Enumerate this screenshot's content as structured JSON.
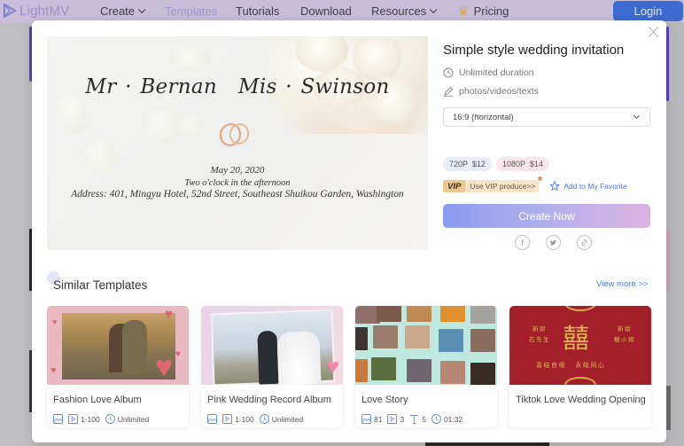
{
  "nav": {
    "logo": "LightMV",
    "items": [
      {
        "label": "Create",
        "dropdown": true
      },
      {
        "label": "Templates",
        "active": true
      },
      {
        "label": "Tutorials"
      },
      {
        "label": "Download"
      },
      {
        "label": "Resources",
        "dropdown": true
      },
      {
        "label": "Pricing",
        "icon": "crown-icon"
      }
    ],
    "login": "Login"
  },
  "modal": {
    "preview": {
      "groom": "Mr · Bernan",
      "bride": "Mis · Swinson",
      "date": "May 20, 2020",
      "time": "Two o'clock in the afternoon",
      "address": "Address: 401, Mingyu Hotel, 52nd Street, Southeast Shuikou Garden, Washington"
    },
    "title": "Simple style wedding invitation",
    "duration": "Unlimited duration",
    "media": "photos/videos/texts",
    "ratio": "16:9 (horizontal)",
    "prices": [
      {
        "label": "720P  $12"
      },
      {
        "label": "1080P  $14"
      }
    ],
    "vip_label": "VIP",
    "vip_text": "Use VIP produce>>",
    "favorite": "Add to My Favorite",
    "create_button": "Create Now",
    "share": [
      "facebook-icon",
      "twitter-icon",
      "link-icon"
    ]
  },
  "similar": {
    "title": "Similar Templates",
    "view_more": "View more >>",
    "cards": [
      {
        "name": "Fashion Love Album",
        "range": "1-100",
        "duration": "Unlimited"
      },
      {
        "name": "Pink Wedding Record Album",
        "range": "1-100",
        "duration": "Unlimited"
      },
      {
        "name": "Love Story",
        "photos": "81",
        "videos": "3",
        "texts": "5",
        "duration": "01:32"
      },
      {
        "name": "Tiktok Love Wedding Opening",
        "art": {
          "left_title": "新郎",
          "left_name": "石先生",
          "right_title": "新娘",
          "right_name": "糖小姐",
          "blessing": "喜结良缘   永结同心"
        }
      }
    ]
  },
  "colors": {
    "accent_blue": "#4a79d8",
    "login_bg": "#3e6bd0",
    "create_gradient_start": "#8a9bf0",
    "create_gradient_end": "#dcb3e0"
  }
}
